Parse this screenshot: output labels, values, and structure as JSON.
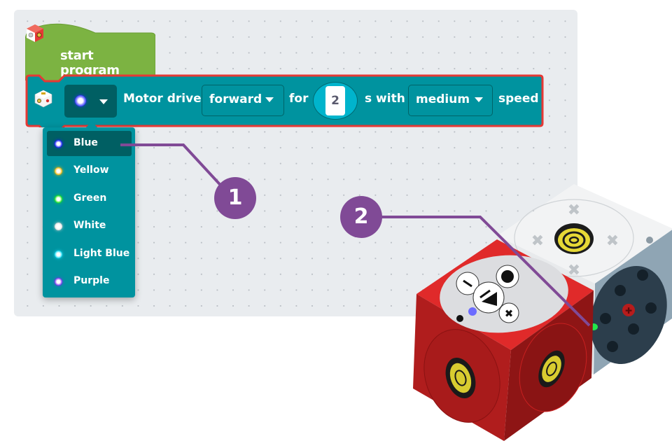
{
  "workspace": {
    "hat_block": {
      "label": "start program",
      "icon": "tinkerbot-cube-icon"
    },
    "motor_block": {
      "icon": "motor-cube-icon",
      "color_dropdown": {
        "selected": "Blue",
        "selected_color": "#2a2aff"
      },
      "label_motor_drive": "Motor drive",
      "direction_dropdown": {
        "value": "forward"
      },
      "label_for": "for",
      "duration_input": {
        "value": "2"
      },
      "label_s_with": "s with",
      "speed_dropdown": {
        "value": "medium"
      },
      "label_speed": "speed"
    },
    "color_menu": {
      "items": [
        {
          "label": "Blue",
          "color": "#1a1aff",
          "selected": true
        },
        {
          "label": "Yellow",
          "color": "#f0b400",
          "selected": false
        },
        {
          "label": "Green",
          "color": "#19e619",
          "selected": false
        },
        {
          "label": "White",
          "color": "#d8d8d8",
          "selected": false
        },
        {
          "label": "Light Blue",
          "color": "#19d9f2",
          "selected": false
        },
        {
          "label": "Purple",
          "color": "#7a2ef0",
          "selected": false
        }
      ]
    }
  },
  "callouts": [
    {
      "number": "1"
    },
    {
      "number": "2"
    }
  ],
  "colors": {
    "block_teal": "#00939f",
    "block_dark_teal": "#005f63",
    "hat_green": "#7cb342",
    "outline_red": "#e53935",
    "callout_purple": "#804a96"
  }
}
